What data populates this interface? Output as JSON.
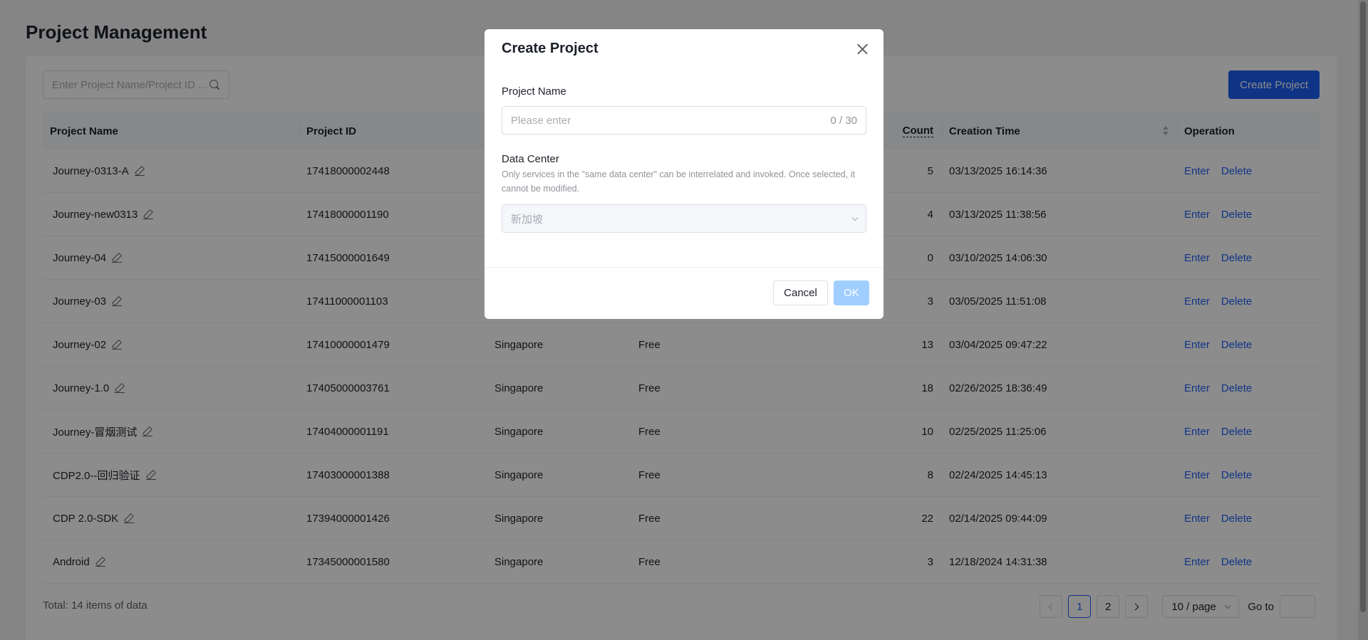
{
  "page": {
    "title": "Project Management"
  },
  "toolbar": {
    "search_placeholder": "Enter Project Name/Project ID ...",
    "create_label": "Create Project"
  },
  "table": {
    "columns": {
      "name": "Project Name",
      "id": "Project ID",
      "count": "Count",
      "time": "Creation Time",
      "operation": "Operation"
    },
    "rows": [
      {
        "name": "Journey-0313-A",
        "id": "17418000002448",
        "dc": "",
        "plan": "",
        "count": "5",
        "time": "03/13/2025 16:14:36"
      },
      {
        "name": "Journey-new0313",
        "id": "17418000001190",
        "dc": "",
        "plan": "",
        "count": "4",
        "time": "03/13/2025 11:38:56"
      },
      {
        "name": "Journey-04",
        "id": "17415000001649",
        "dc": "",
        "plan": "",
        "count": "0",
        "time": "03/10/2025 14:06:30"
      },
      {
        "name": "Journey-03",
        "id": "17411000001103",
        "dc": "",
        "plan": "",
        "count": "3",
        "time": "03/05/2025 11:51:08"
      },
      {
        "name": "Journey-02",
        "id": "17410000001479",
        "dc": "Singapore",
        "plan": "Free",
        "count": "13",
        "time": "03/04/2025 09:47:22"
      },
      {
        "name": "Journey-1.0",
        "id": "17405000003761",
        "dc": "Singapore",
        "plan": "Free",
        "count": "18",
        "time": "02/26/2025 18:36:49"
      },
      {
        "name": "Journey-冒烟测试",
        "id": "17404000001191",
        "dc": "Singapore",
        "plan": "Free",
        "count": "10",
        "time": "02/25/2025 11:25:06"
      },
      {
        "name": "CDP2.0--回归验证",
        "id": "17403000001388",
        "dc": "Singapore",
        "plan": "Free",
        "count": "8",
        "time": "02/24/2025 14:45:13"
      },
      {
        "name": "CDP 2.0-SDK",
        "id": "17394000001426",
        "dc": "Singapore",
        "plan": "Free",
        "count": "22",
        "time": "02/14/2025 09:44:09"
      },
      {
        "name": "Android",
        "id": "17345000001580",
        "dc": "Singapore",
        "plan": "Free",
        "count": "3",
        "time": "12/18/2024 14:31:38"
      }
    ],
    "enter_label": "Enter",
    "delete_label": "Delete"
  },
  "footer": {
    "total": "Total: 14 items of data",
    "pages": [
      "1",
      "2"
    ],
    "page_size": "10 / page",
    "goto_label": "Go to"
  },
  "modal": {
    "title": "Create Project",
    "name_label": "Project Name",
    "name_placeholder": "Please enter",
    "name_counter": "0 / 30",
    "dc_label": "Data Center",
    "dc_help": "Only services in the \"same data center\" can be interrelated and invoked. Once selected, it cannot be modified.",
    "dc_value": "新加坡",
    "cancel_label": "Cancel",
    "ok_label": "OK"
  },
  "colors": {
    "primary": "#1d5ff5",
    "ok_disabled": "#a0cfff"
  }
}
